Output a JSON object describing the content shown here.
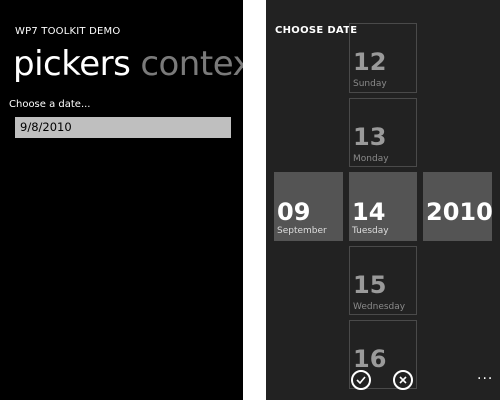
{
  "left_screen": {
    "app_title": "WP7 TOOLKIT DEMO",
    "pivot": [
      {
        "label": "pickers",
        "active": true
      },
      {
        "label": "context",
        "active": false
      }
    ],
    "date_prompt": "Choose a date...",
    "date_value": "9/8/2010"
  },
  "right_screen": {
    "header": "CHOOSE DATE",
    "day_column": [
      {
        "number": "12",
        "label": "Sunday"
      },
      {
        "number": "13",
        "label": "Monday"
      },
      {
        "number": "14",
        "label": "Tuesday",
        "selected": true
      },
      {
        "number": "15",
        "label": "Wednesday"
      },
      {
        "number": "16",
        "label": ""
      }
    ],
    "month": {
      "number": "09",
      "label": "September"
    },
    "year": {
      "number": "2010"
    },
    "app_bar": {
      "icons": [
        "check-icon",
        "cancel-icon",
        "more-icon"
      ],
      "more_label": "..."
    }
  },
  "colors": {
    "background": "#000000",
    "picker_background": "#222222",
    "selected_tile": "#545454",
    "tile_border": "#4a4a4a",
    "field_background": "#bfbfbf",
    "inactive_text": "#7a7a7a"
  }
}
